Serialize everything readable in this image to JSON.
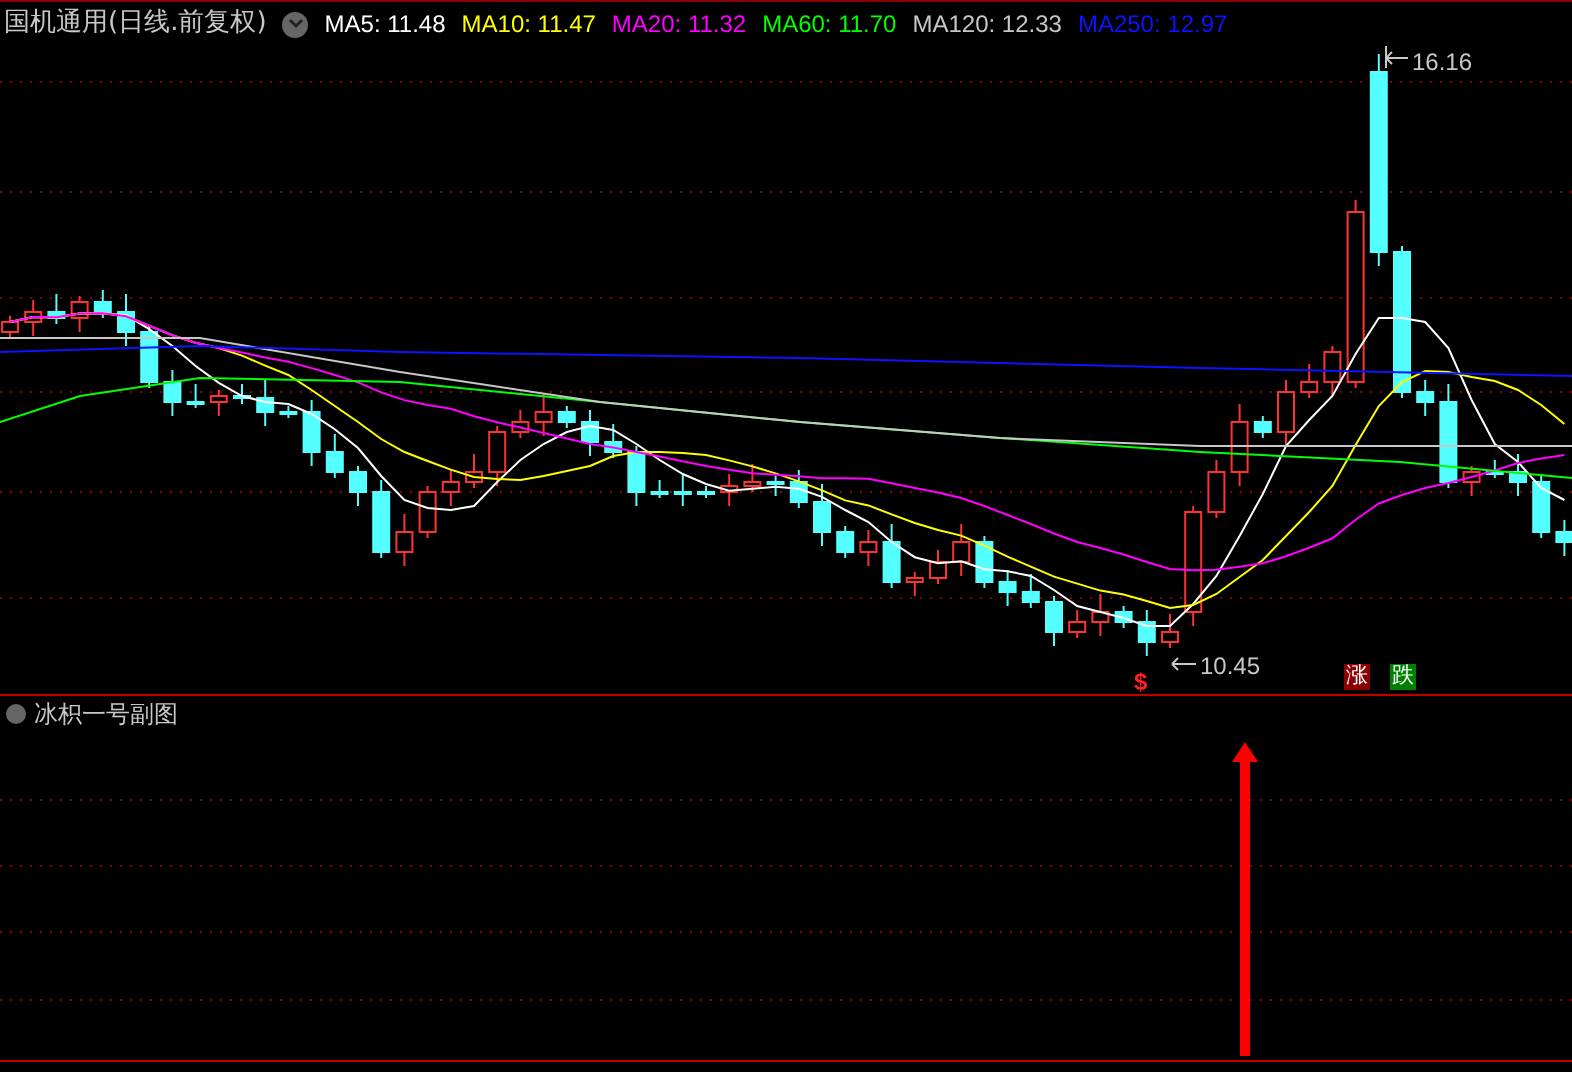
{
  "header": {
    "title": "国机通用(日线.前复权)",
    "indicators": [
      {
        "label": "MA5: 11.48",
        "color": "#ffffff"
      },
      {
        "label": "MA10: 11.47",
        "color": "#ffff00"
      },
      {
        "label": "MA20: 11.32",
        "color": "#ff00ff"
      },
      {
        "label": "MA60: 11.70",
        "color": "#00ff00"
      },
      {
        "label": "MA120: 12.33",
        "color": "#c8c8c8"
      },
      {
        "label": "MA250: 12.97",
        "color": "#0a14ff"
      }
    ]
  },
  "main_chart": {
    "high_label": "16.16",
    "low_label": "10.45",
    "signal_marker": "$",
    "badges": [
      {
        "text": "涨",
        "kind": "rise"
      },
      {
        "text": "跌",
        "kind": "fall"
      }
    ]
  },
  "sub_chart": {
    "title": "冰枳一号副图"
  }
}
